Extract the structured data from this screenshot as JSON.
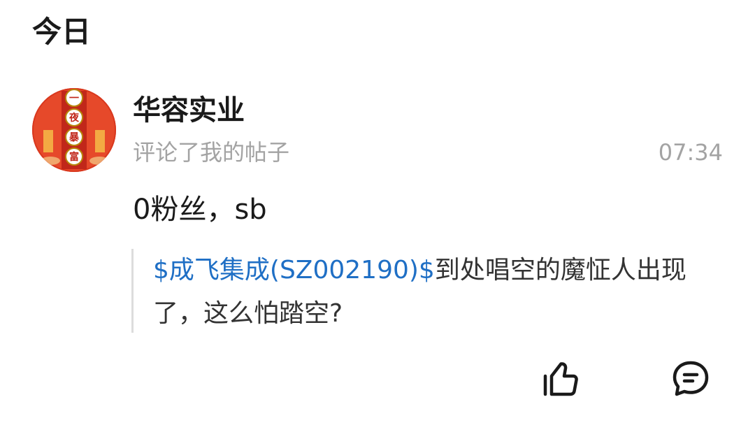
{
  "section": {
    "title": "今日"
  },
  "notification": {
    "avatar_icon": "user-avatar-red-lantern",
    "avatar_chars": [
      "一",
      "夜",
      "暴",
      "富"
    ],
    "username": "华容实业",
    "action": "评论了我的帖子",
    "time": "07:34",
    "comment": "0粉丝，sb",
    "quoted_post": {
      "stock_link": "$成飞集成(SZ002190)$",
      "text": "到处唱空的魔怔人出现了，这么怕踏空?"
    },
    "actions": {
      "like_icon": "thumbs-up-icon",
      "reply_icon": "comment-bubble-icon"
    }
  },
  "colors": {
    "link": "#1f6fc5",
    "secondary_text": "#a3a3a3",
    "primary_text": "#1a1a1a",
    "quote_border": "#dcdcdc",
    "avatar_bg": "#d9381e"
  }
}
